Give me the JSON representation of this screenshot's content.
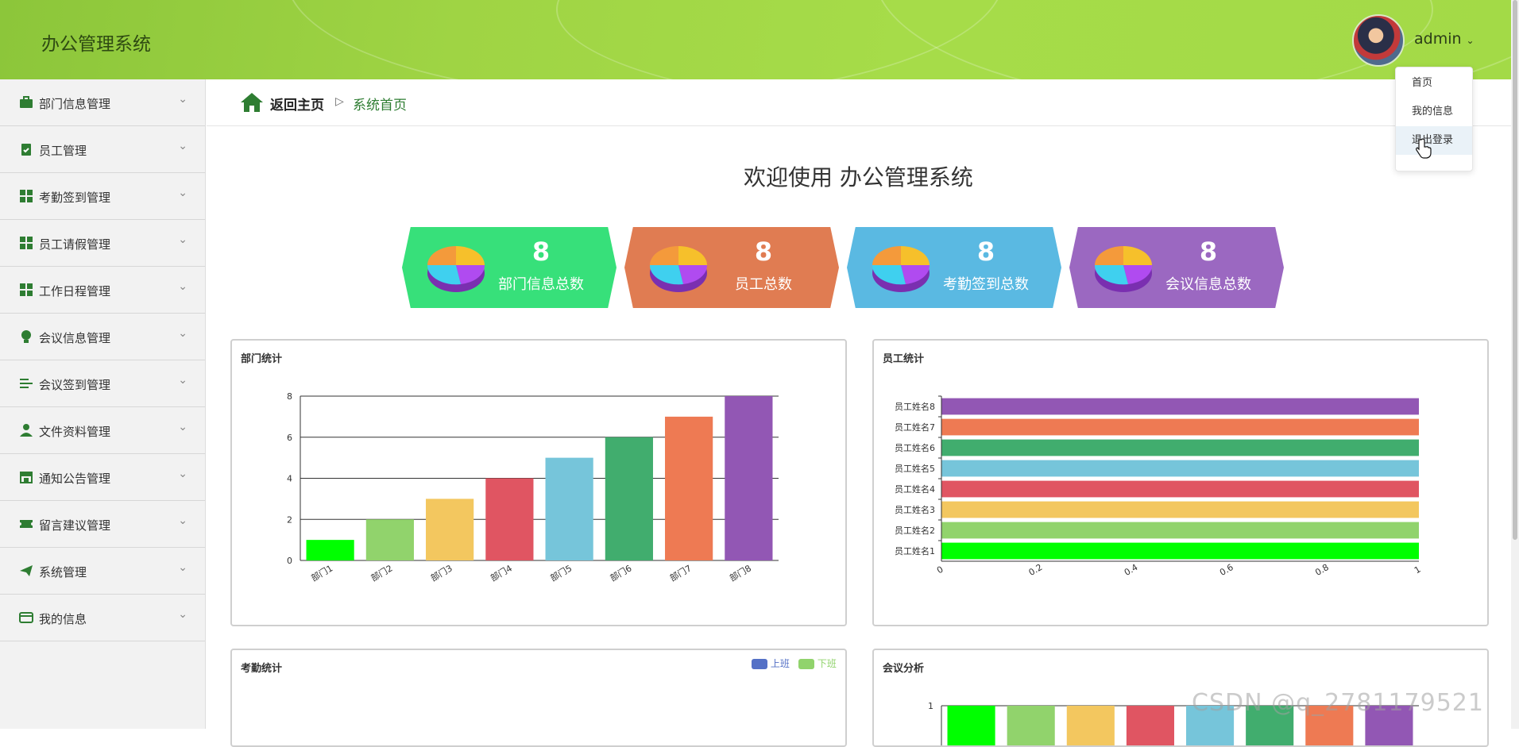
{
  "app": {
    "title": "办公管理系统"
  },
  "header": {
    "username": "admin",
    "caret": "⌄"
  },
  "dropdown": {
    "items": [
      "首页",
      "我的信息",
      "退出登录"
    ]
  },
  "sidebar": {
    "items": [
      {
        "label": "部门信息管理",
        "icon": "briefcase-icon"
      },
      {
        "label": "员工管理",
        "icon": "clipboard-check-icon"
      },
      {
        "label": "考勤签到管理",
        "icon": "grid-icon"
      },
      {
        "label": "员工请假管理",
        "icon": "grid-icon"
      },
      {
        "label": "工作日程管理",
        "icon": "grid-icon"
      },
      {
        "label": "会议信息管理",
        "icon": "lightbulb-icon"
      },
      {
        "label": "会议签到管理",
        "icon": "list-icon"
      },
      {
        "label": "文件资料管理",
        "icon": "user-icon"
      },
      {
        "label": "通知公告管理",
        "icon": "store-icon"
      },
      {
        "label": "留言建议管理",
        "icon": "ticket-icon"
      },
      {
        "label": "系统管理",
        "icon": "paper-plane-icon"
      },
      {
        "label": "我的信息",
        "icon": "card-icon"
      }
    ],
    "chevron": "⌄"
  },
  "breadcrumb": {
    "home": "返回主页",
    "separator": "▷",
    "current": "系统首页"
  },
  "welcome": "欢迎使用 办公管理系统",
  "stats": [
    {
      "value": "8",
      "label": "部门信息总数",
      "color": "#37e07a"
    },
    {
      "value": "8",
      "label": "员工总数",
      "color": "#e07c52"
    },
    {
      "value": "8",
      "label": "考勤签到总数",
      "color": "#5ab9e2"
    },
    {
      "value": "8",
      "label": "会议信息总数",
      "color": "#9b68c1"
    }
  ],
  "panels": {
    "dept": {
      "title": "部门统计"
    },
    "emp": {
      "title": "员工统计"
    },
    "attend": {
      "title": "考勤统计",
      "legend": [
        "上班",
        "下班"
      ]
    },
    "meeting": {
      "title": "会议分析"
    }
  },
  "watermark": "CSDN @q_2781179521",
  "chart_data": [
    {
      "type": "bar",
      "title": "部门统计",
      "categories": [
        "部门1",
        "部门2",
        "部门3",
        "部门4",
        "部门5",
        "部门6",
        "部门7",
        "部门8"
      ],
      "values": [
        1,
        2,
        3,
        4,
        5,
        6,
        7,
        8
      ],
      "colors": [
        "#00ff00",
        "#91d36c",
        "#f3c75f",
        "#e05562",
        "#76c5da",
        "#41ad6e",
        "#ee7a53",
        "#9257b4"
      ],
      "ylim": [
        0,
        8
      ],
      "yticks": [
        "0",
        "2",
        "4",
        "6",
        "8"
      ],
      "grid": true
    },
    {
      "type": "bar",
      "orientation": "horizontal",
      "title": "员工统计",
      "categories": [
        "员工姓名1",
        "员工姓名2",
        "员工姓名3",
        "员工姓名4",
        "员工姓名5",
        "员工姓名6",
        "员工姓名7",
        "员工姓名8"
      ],
      "values": [
        1,
        1,
        1,
        1,
        1,
        1,
        1,
        1
      ],
      "colors": [
        "#00ff00",
        "#91d36c",
        "#f3c75f",
        "#e05562",
        "#76c5da",
        "#41ad6e",
        "#ee7a53",
        "#9257b4"
      ],
      "xlim": [
        0,
        1
      ],
      "xticks": [
        "0",
        "0.2",
        "0.4",
        "0.6",
        "0.8",
        "1"
      ]
    },
    {
      "type": "bar",
      "title": "考勤统计",
      "legend": [
        "上班",
        "下班"
      ],
      "legend_colors": [
        "#5470c6",
        "#91d36c"
      ],
      "legend_position": "top-right"
    },
    {
      "type": "bar",
      "title": "会议分析",
      "values": [
        1,
        1,
        1,
        1,
        1,
        1,
        1,
        1
      ],
      "colors": [
        "#00ff00",
        "#91d36c",
        "#f3c75f",
        "#e05562",
        "#76c5da",
        "#41ad6e",
        "#ee7a53",
        "#9257b4"
      ],
      "yticks": [
        "1"
      ]
    }
  ]
}
